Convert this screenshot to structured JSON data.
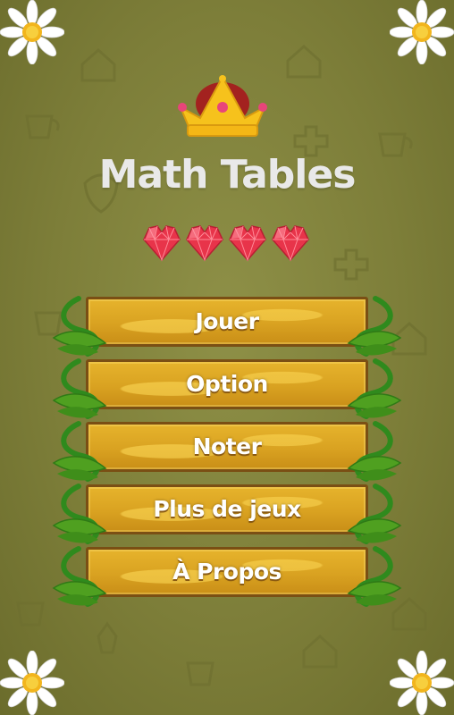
{
  "app": {
    "title": "Math Tables"
  },
  "lives": {
    "count": 4,
    "icon": "heart-gem-icon",
    "color": "#e8344a"
  },
  "menu": {
    "items": [
      {
        "label": "Jouer"
      },
      {
        "label": "Option"
      },
      {
        "label": "Noter"
      },
      {
        "label": "Plus de jeux"
      },
      {
        "label": "À Propos"
      }
    ]
  },
  "colors": {
    "background": "#7d7e39",
    "plank": "#d9a221",
    "plank_border": "#7a4f14",
    "title": "#e9e9e9",
    "leaf": "#4fa020"
  }
}
